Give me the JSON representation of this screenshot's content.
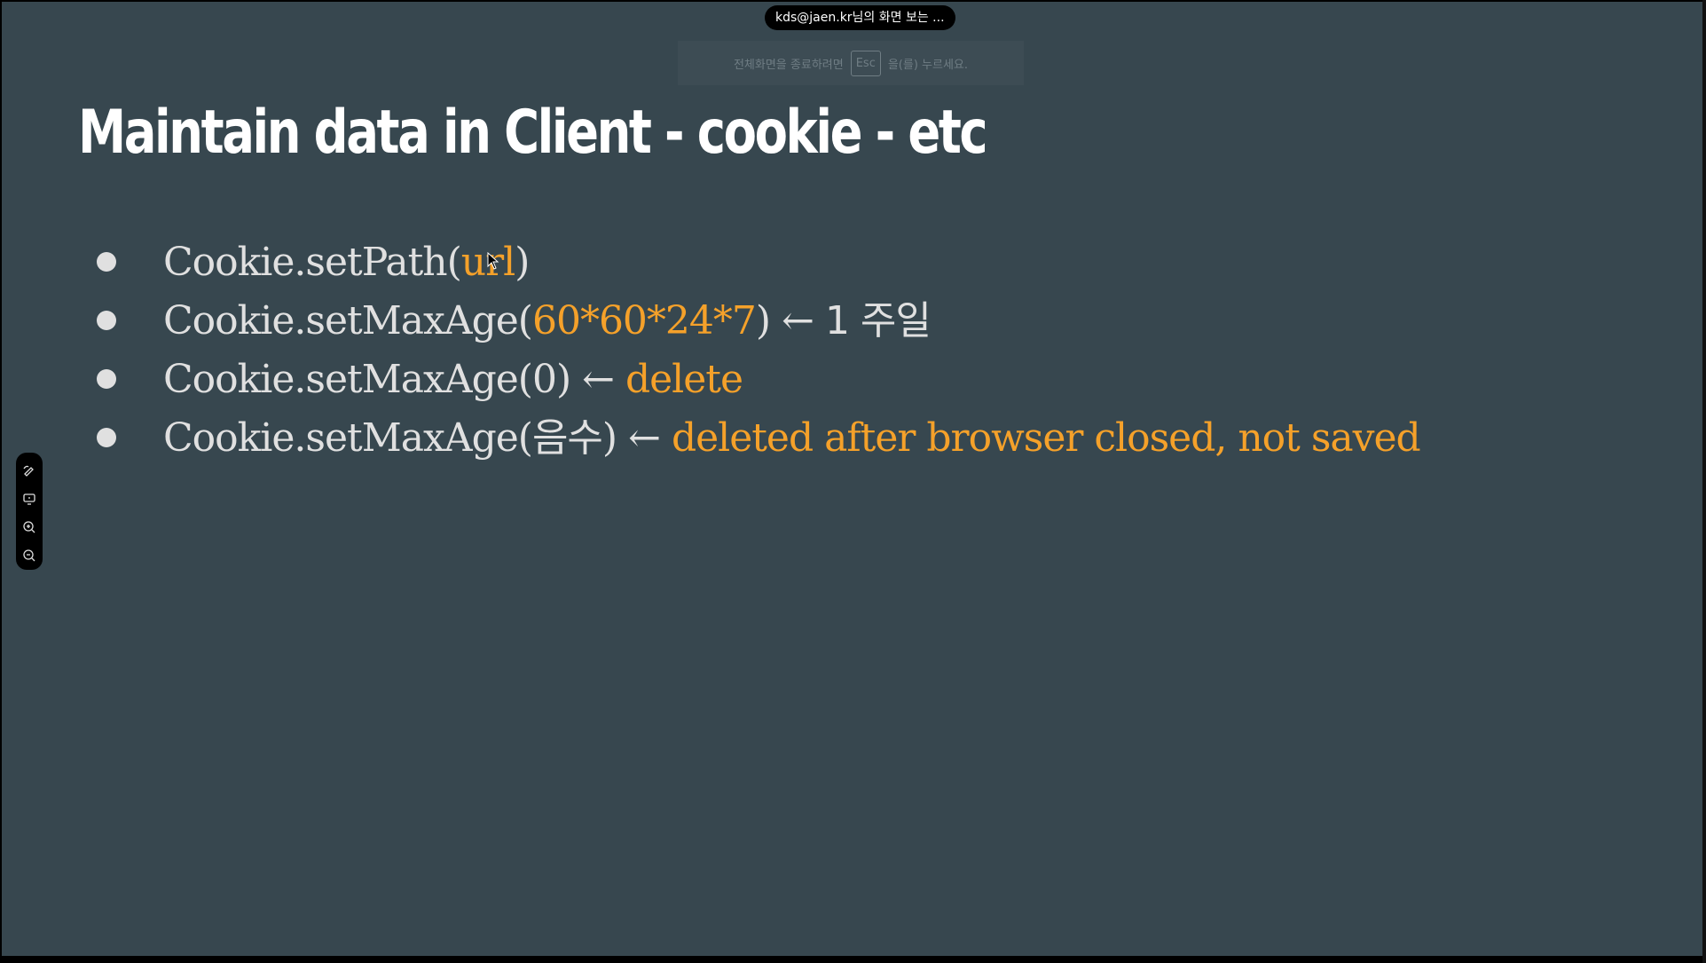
{
  "banner": {
    "text": "kds@jaen.kr님의 화면 보는 ..."
  },
  "fullscreen_hint": {
    "before": "전체화면을 종료하려면",
    "key": "Esc",
    "after": "을(를) 누르세요."
  },
  "slide": {
    "title": "Maintain data in Client - cookie - etc",
    "bullets": [
      {
        "code": "Cookie.setPath(",
        "arg": "url",
        "close": ")",
        "arrow": "",
        "note": "",
        "note_highlight": false
      },
      {
        "code": "Cookie.setMaxAge(",
        "arg": "60*60*24*7",
        "close": ")",
        "arrow": " ← ",
        "note": "1 주일",
        "note_highlight": false
      },
      {
        "code": "Cookie.setMaxAge(",
        "arg": "0",
        "close": ")",
        "arrow": " ← ",
        "note": "delete",
        "note_highlight": true
      },
      {
        "code": "Cookie.setMaxAge(",
        "arg": "음수",
        "close": ")",
        "arrow": " ← ",
        "note": "deleted after browser closed, not saved",
        "note_highlight": true
      }
    ]
  },
  "toolbar": {
    "icons": [
      "draw-icon",
      "screen-share-icon",
      "zoom-in-icon",
      "zoom-out-icon"
    ]
  },
  "colors": {
    "background": "#37474f",
    "text": "#e0e0e0",
    "highlight": "#f5a12a",
    "title": "#ffffff"
  }
}
